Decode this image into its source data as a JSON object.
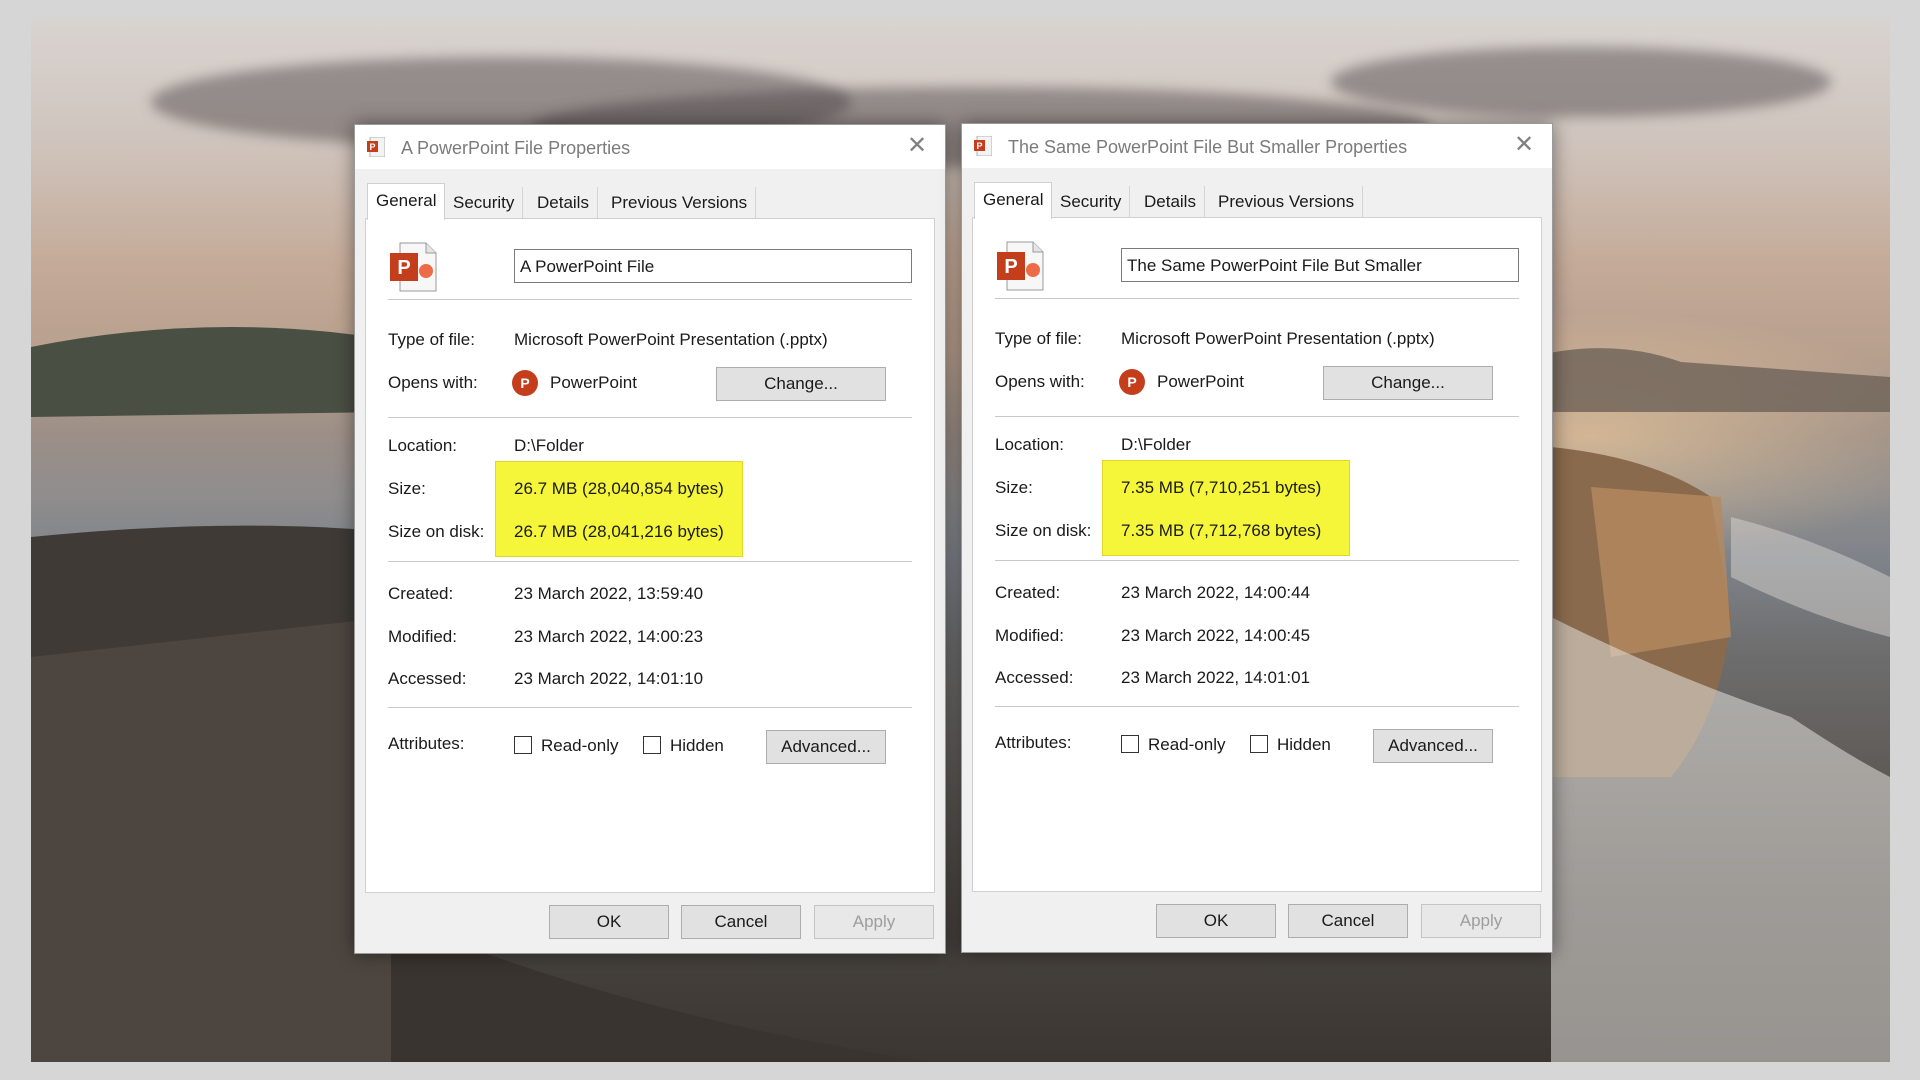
{
  "dialogs": [
    {
      "title": "A PowerPoint File Properties",
      "tabs": [
        "General",
        "Security",
        "Details",
        "Previous Versions"
      ],
      "file_name": "A PowerPoint File",
      "type_label": "Type of file:",
      "type_value": "Microsoft PowerPoint Presentation (.pptx)",
      "opens_label": "Opens with:",
      "opens_value": "PowerPoint",
      "change_label": "Change...",
      "location_label": "Location:",
      "location_value": "D:\\Folder",
      "size_label": "Size:",
      "size_value": "26.7 MB (28,040,854 bytes)",
      "disk_label": "Size on disk:",
      "disk_value": "26.7 MB (28,041,216 bytes)",
      "created_label": "Created:",
      "created_value": "23 March 2022, 13:59:40",
      "modified_label": "Modified:",
      "modified_value": "23 March 2022, 14:00:23",
      "accessed_label": "Accessed:",
      "accessed_value": "23 March 2022, 14:01:10",
      "attributes_label": "Attributes:",
      "readonly_label": "Read-only",
      "hidden_label": "Hidden",
      "advanced_label": "Advanced...",
      "ok_label": "OK",
      "cancel_label": "Cancel",
      "apply_label": "Apply"
    },
    {
      "title": "The Same PowerPoint File But Smaller Properties",
      "tabs": [
        "General",
        "Security",
        "Details",
        "Previous Versions"
      ],
      "file_name": "The Same PowerPoint File But Smaller",
      "type_label": "Type of file:",
      "type_value": "Microsoft PowerPoint Presentation (.pptx)",
      "opens_label": "Opens with:",
      "opens_value": "PowerPoint",
      "change_label": "Change...",
      "location_label": "Location:",
      "location_value": "D:\\Folder",
      "size_label": "Size:",
      "size_value": "7.35 MB (7,710,251 bytes)",
      "disk_label": "Size on disk:",
      "disk_value": "7.35 MB (7,712,768 bytes)",
      "created_label": "Created:",
      "created_value": "23 March 2022, 14:00:44",
      "modified_label": "Modified:",
      "modified_value": "23 March 2022, 14:00:45",
      "accessed_label": "Accessed:",
      "accessed_value": "23 March 2022, 14:01:01",
      "attributes_label": "Attributes:",
      "readonly_label": "Read-only",
      "hidden_label": "Hidden",
      "advanced_label": "Advanced...",
      "ok_label": "OK",
      "cancel_label": "Cancel",
      "apply_label": "Apply"
    }
  ],
  "icons": {
    "file_icon": "powerpoint-file-icon",
    "app_icon": "powerpoint-app-icon",
    "close": "close-icon",
    "checkbox": "checkbox-unchecked"
  },
  "colors": {
    "highlight": "#f5f53a",
    "powerpoint_brand": "#c43e1c"
  }
}
